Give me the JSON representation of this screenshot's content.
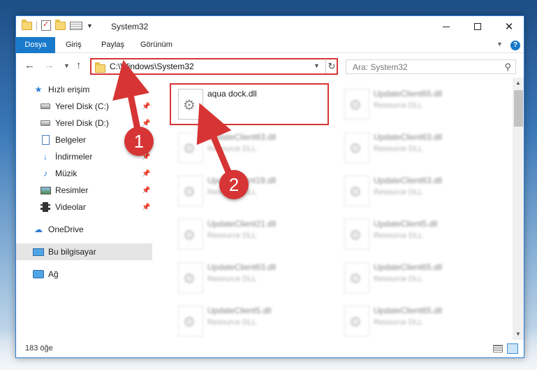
{
  "window": {
    "title": "System32",
    "controls": {
      "minimize": "–",
      "maximize": "",
      "close": "✕"
    }
  },
  "ribbon": {
    "tabs": [
      "Dosya",
      "Giriş",
      "Paylaş",
      "Görünüm"
    ],
    "help": "?"
  },
  "navigation": {
    "address": "C:\\Windows\\System32",
    "search_placeholder": "Ara: System32"
  },
  "sidebar": {
    "quick_access": "Hızlı erişim",
    "items": [
      {
        "label": "Yerel Disk (C:)",
        "icon": "drive-icon",
        "pinned": true
      },
      {
        "label": "Yerel Disk (D:)",
        "icon": "drive-icon",
        "pinned": true
      },
      {
        "label": "Belgeler",
        "icon": "documents-icon",
        "pinned": true
      },
      {
        "label": "İndirmeler",
        "icon": "downloads-icon",
        "pinned": true
      },
      {
        "label": "Müzik",
        "icon": "music-icon",
        "pinned": true
      },
      {
        "label": "Resimler",
        "icon": "pictures-icon",
        "pinned": true
      },
      {
        "label": "Videolar",
        "icon": "videos-icon",
        "pinned": true
      }
    ],
    "onedrive": "OneDrive",
    "this_pc": "Bu bilgisayar",
    "network": "Ağ"
  },
  "files": {
    "highlighted": {
      "name": "aqua dock.dll",
      "type": ""
    },
    "items": [
      {
        "name": "UpdateClient65.dll",
        "type": "Resource DLL"
      },
      {
        "name": "UpdateClient63.dll",
        "type": "Resource DLL"
      },
      {
        "name": "UpdateClient63.dll",
        "type": "Resource DLL"
      },
      {
        "name": "UpdateClient19.dll",
        "type": "Resource DLL"
      },
      {
        "name": "UpdateClient63.dll",
        "type": "Resource DLL"
      },
      {
        "name": "UpdateClient21.dll",
        "type": "Resource DLL"
      },
      {
        "name": "UpdateClient5.dll",
        "type": "Resource DLL"
      },
      {
        "name": "UpdateClient63.dll",
        "type": "Resource DLL"
      },
      {
        "name": "UpdateClient65.dll",
        "type": "Resource DLL"
      },
      {
        "name": "UpdateClient5.dll",
        "type": "Resource DLL"
      },
      {
        "name": "UpdateClient65.dll",
        "type": "Resource DLL"
      }
    ]
  },
  "status": {
    "count": "183 öğe"
  },
  "callouts": {
    "one": "1",
    "two": "2"
  },
  "colors": {
    "accent": "#1979ca",
    "highlight": "#d73535"
  }
}
